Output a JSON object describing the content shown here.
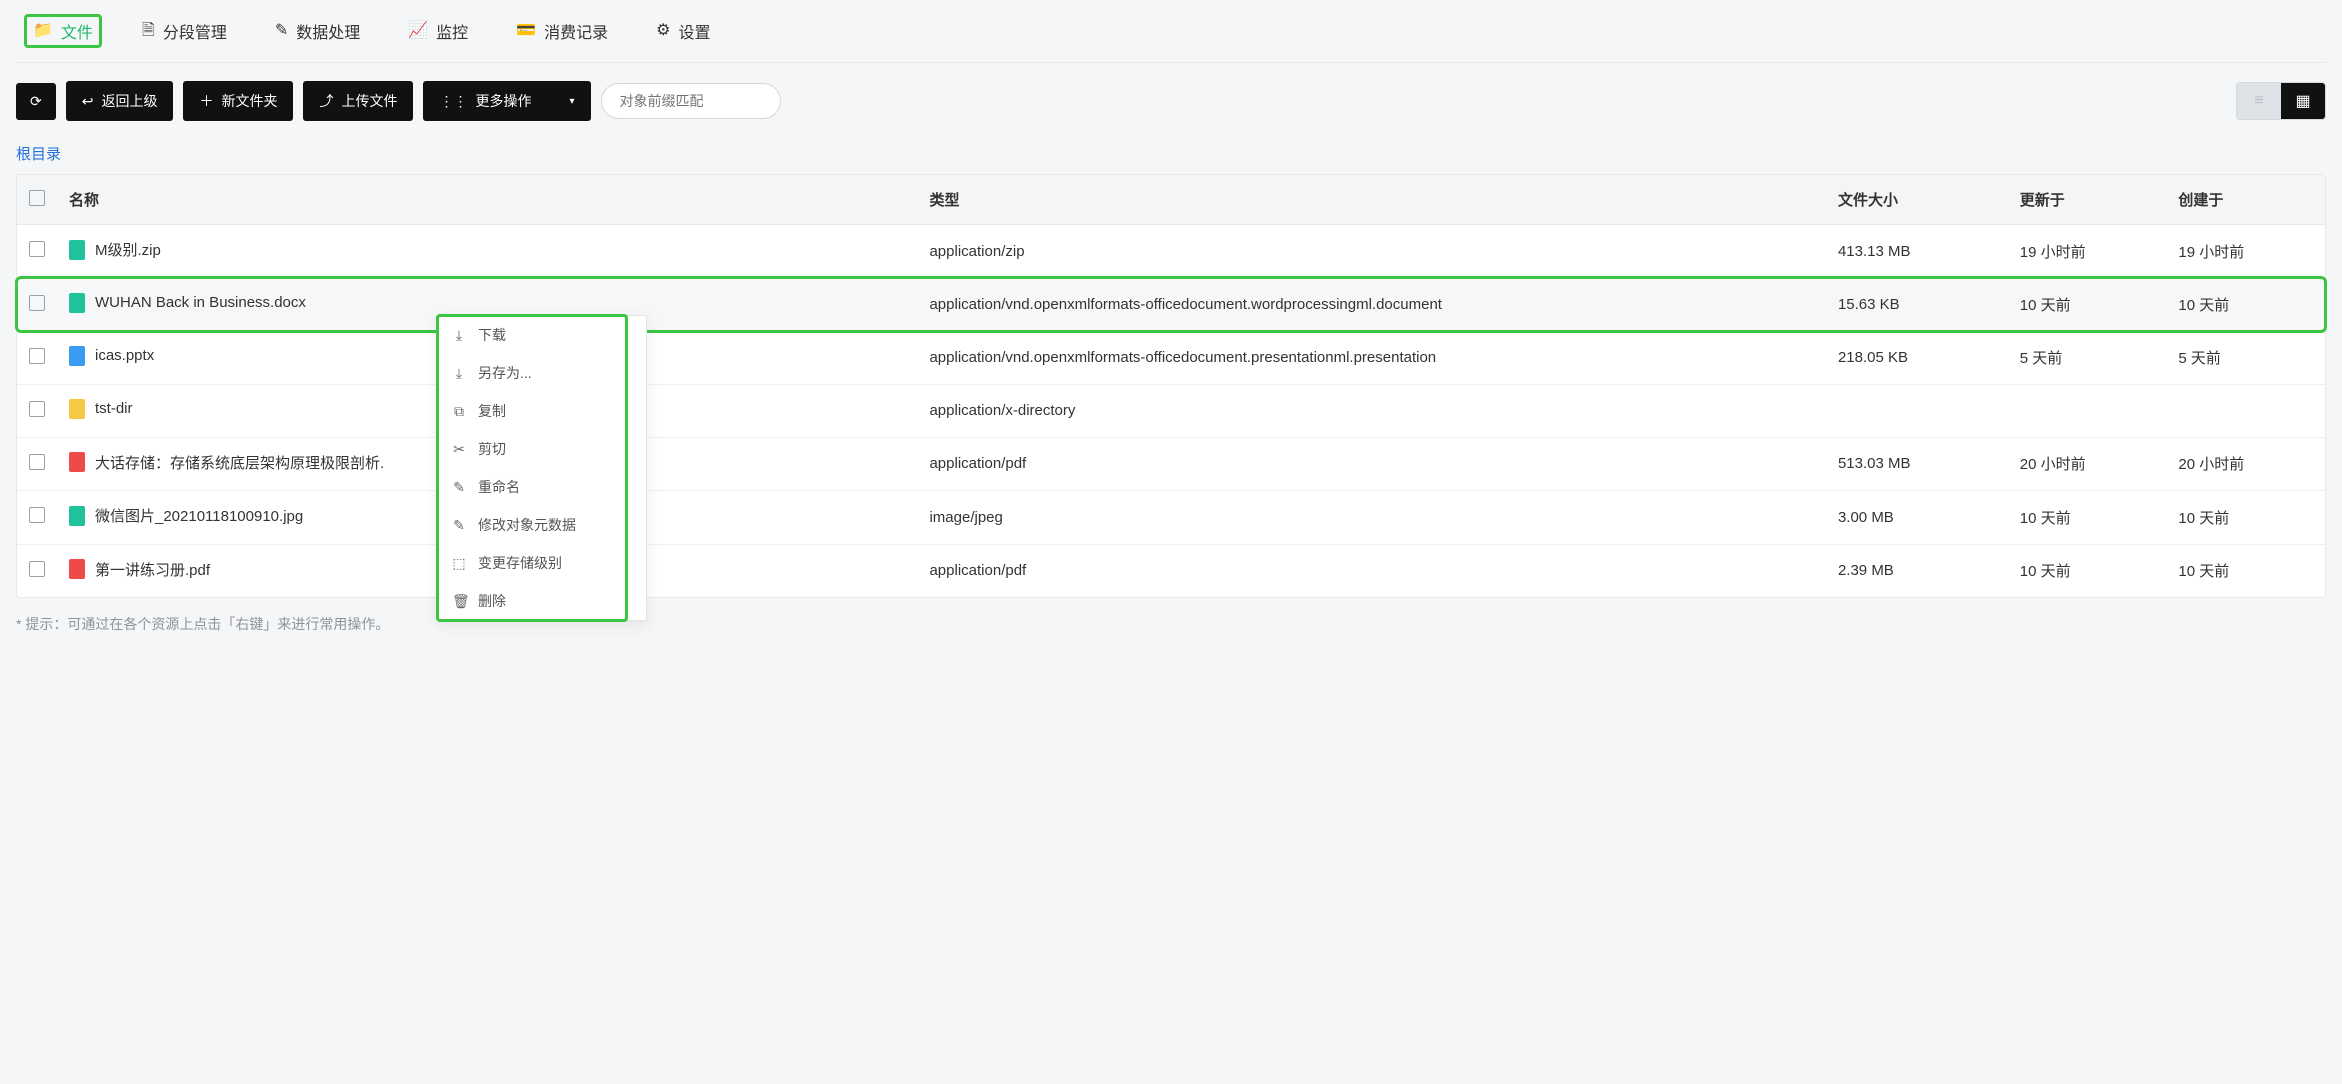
{
  "tabs": [
    {
      "label": "文件",
      "icon": "folder-icon",
      "active": true
    },
    {
      "label": "分段管理",
      "icon": "file-outline-icon",
      "active": false
    },
    {
      "label": "数据处理",
      "icon": "edit-icon",
      "active": false
    },
    {
      "label": "监控",
      "icon": "chart-icon",
      "active": false
    },
    {
      "label": "消费记录",
      "icon": "card-icon",
      "active": false
    },
    {
      "label": "设置",
      "icon": "gear-icon",
      "active": false
    }
  ],
  "toolbar": {
    "back_label": "返回上级",
    "new_folder_label": "新文件夹",
    "upload_label": "上传文件",
    "more_label": "更多操作",
    "search_placeholder": "对象前缀匹配"
  },
  "breadcrumb": "根目录",
  "columns": {
    "name": "名称",
    "type": "类型",
    "size": "文件大小",
    "updated": "更新于",
    "created": "创建于"
  },
  "rows": [
    {
      "name": "M级别.zip",
      "type": "application/zip",
      "size": "413.13 MB",
      "updated": "19 小时前",
      "created": "19 小时前",
      "ico": "ico-zip"
    },
    {
      "name": "WUHAN Back in Business.docx",
      "type": "application/vnd.openxmlformats-officedocument.wordprocessingml.document",
      "size": "15.63 KB",
      "updated": "10 天前",
      "created": "10 天前",
      "ico": "ico-docx",
      "highlight": true
    },
    {
      "name": "icas.pptx",
      "type": "application/vnd.openxmlformats-officedocument.presentationml.presentation",
      "size": "218.05 KB",
      "updated": "5 天前",
      "created": "5 天前",
      "ico": "ico-pptx"
    },
    {
      "name": "tst-dir",
      "type": "application/x-directory",
      "size": "",
      "updated": "",
      "created": "",
      "ico": "ico-dir"
    },
    {
      "name": "大话存储：存储系统底层架构原理极限剖析.",
      "type": "application/pdf",
      "size": "513.03 MB",
      "updated": "20 小时前",
      "created": "20 小时前",
      "ico": "ico-pdf"
    },
    {
      "name": "微信图片_20210118100910.jpg",
      "type": "image/jpeg",
      "size": "3.00 MB",
      "updated": "10 天前",
      "created": "10 天前",
      "ico": "ico-jpg"
    },
    {
      "name": "第一讲练习册.pdf",
      "type": "application/pdf",
      "size": "2.39 MB",
      "updated": "10 天前",
      "created": "10 天前",
      "ico": "ico-pdf"
    }
  ],
  "context_menu": [
    {
      "label": "下载",
      "icon": "download-icon"
    },
    {
      "label": "另存为...",
      "icon": "save-as-icon"
    },
    {
      "label": "复制",
      "icon": "copy-icon"
    },
    {
      "label": "剪切",
      "icon": "cut-icon"
    },
    {
      "label": "重命名",
      "icon": "pencil-icon"
    },
    {
      "label": "修改对象元数据",
      "icon": "edit-meta-icon"
    },
    {
      "label": "变更存储级别",
      "icon": "storage-icon"
    },
    {
      "label": "删除",
      "icon": "trash-icon"
    }
  ],
  "hint": "* 提示：可通过在各个资源上点击「右键」来进行常用操作。",
  "glyphs": {
    "folder-icon": "📁",
    "file-outline-icon": "🗎",
    "edit-icon": "✎",
    "chart-icon": "📈",
    "card-icon": "💳",
    "gear-icon": "⚙",
    "refresh-icon": "⟳",
    "back-icon": "↩",
    "plus-icon": "＋",
    "upload-icon": "⤴",
    "more-icon": "⋮⋮",
    "caret-down": "▾",
    "list-icon": "≡",
    "grid-icon": "▦",
    "download-icon": "⤓",
    "save-as-icon": "⤓",
    "copy-icon": "⧉",
    "cut-icon": "✂",
    "pencil-icon": "✎",
    "edit-meta-icon": "✎",
    "storage-icon": "⬚",
    "trash-icon": "🗑"
  }
}
